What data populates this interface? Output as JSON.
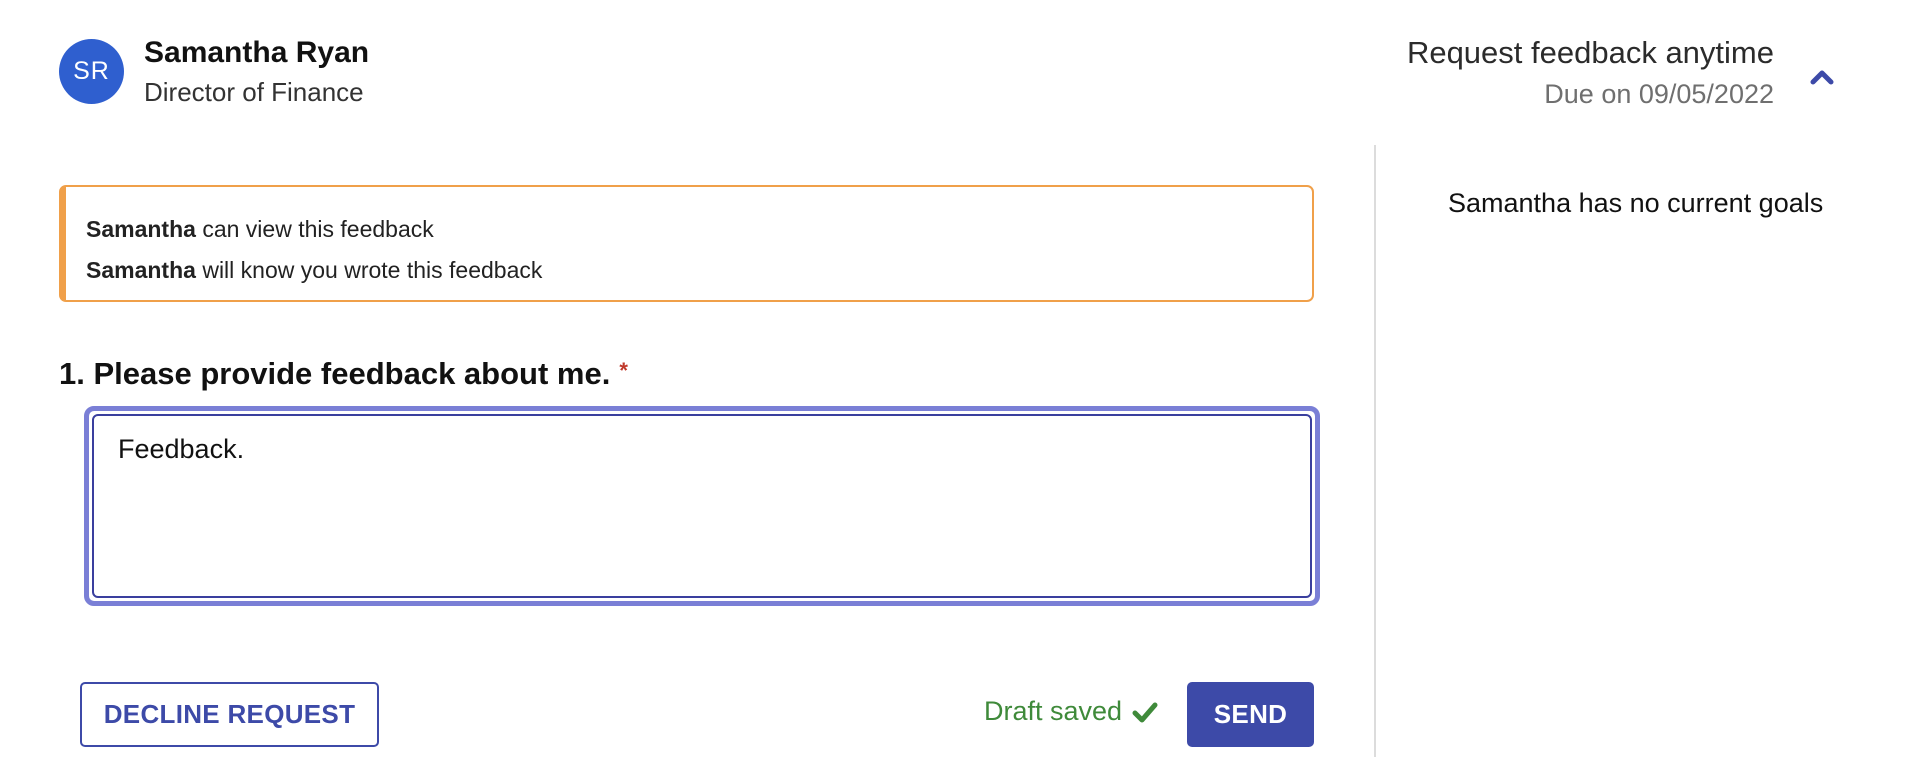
{
  "recipient": {
    "initials": "SR",
    "name": "Samantha Ryan",
    "role": "Director of Finance",
    "avatar_color": "#2f5fcf"
  },
  "request": {
    "title": "Request feedback anytime",
    "due": "Due on 09/05/2022",
    "toggle_icon": "chevron-up-icon"
  },
  "visibility_notice": {
    "accent_color": "#f0a04a",
    "lines": [
      {
        "name": "Samantha",
        "text": " can view this feedback"
      },
      {
        "name": "Samantha",
        "text": " will know you wrote this feedback"
      }
    ]
  },
  "question": {
    "label": "1. Please provide feedback about me.",
    "required_mark": "*",
    "answer_value": "Feedback."
  },
  "actions": {
    "decline_label": "DECLINE REQUEST",
    "draft_status": "Draft saved",
    "draft_icon": "checkmark-icon",
    "send_label": "SEND",
    "primary_color": "#3d4aa8",
    "success_color": "#3f8a3a"
  },
  "goals_panel": {
    "empty_text": "Samantha has no current goals"
  }
}
